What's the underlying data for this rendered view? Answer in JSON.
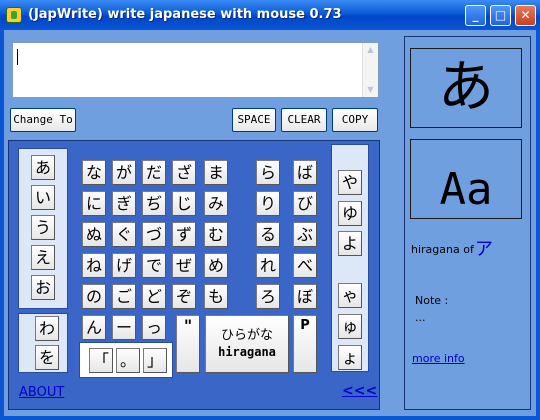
{
  "window": {
    "title": "(JapWrite) write japanese with mouse 0.73",
    "minimize": "_",
    "maximize": "□",
    "close": "✕"
  },
  "buttons": {
    "change_to": "Change To",
    "space": "SPACE",
    "clear": "CLEAR",
    "copy": "COPY"
  },
  "vowels": [
    "あ",
    "い",
    "う",
    "え",
    "お"
  ],
  "wa_col": [
    "わ",
    "を"
  ],
  "main_keys": {
    "row1": [
      "な",
      "が",
      "だ",
      "ざ",
      "ま"
    ],
    "row2": [
      "に",
      "ぎ",
      "ぢ",
      "じ",
      "み"
    ],
    "row3": [
      "ぬ",
      "ぐ",
      "づ",
      "ず",
      "む"
    ],
    "row4": [
      "ね",
      "げ",
      "で",
      "ぜ",
      "め"
    ],
    "row5": [
      "の",
      "ご",
      "ど",
      "ぞ",
      "も"
    ],
    "row6": [
      "ん",
      "ー",
      "っ"
    ]
  },
  "punct": [
    "「",
    "。",
    "」"
  ],
  "r_col": [
    "ら",
    "り",
    "る",
    "れ",
    "ろ"
  ],
  "b_col": [
    "ば",
    "び",
    "ぶ",
    "べ",
    "ぼ"
  ],
  "ya_col": [
    "や",
    "ゆ",
    "よ"
  ],
  "small_ya_col": [
    "ゃ",
    "ゅ",
    "ょ"
  ],
  "dakuten": "\"",
  "hiragana_btn": {
    "line1": "ひらがな",
    "line2": "hiragana"
  },
  "p_btn": "P",
  "links": {
    "about": "ABOUT",
    "back": "<<<",
    "more_info": "more info"
  },
  "preview": {
    "glyph": "あ",
    "romaji": "Aa",
    "label": "hiragana of",
    "katakana": "ア",
    "note_label": "Note :",
    "note_value": "..."
  }
}
